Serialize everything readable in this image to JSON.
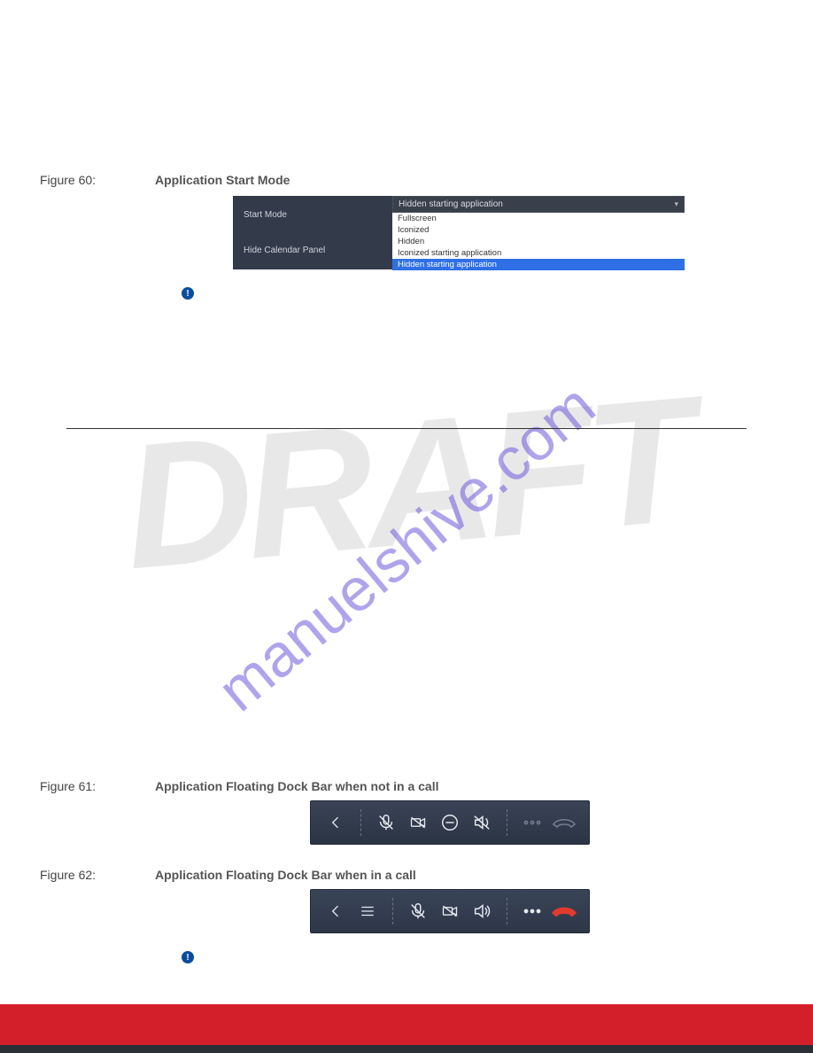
{
  "watermarks": {
    "draft": "DRAFT",
    "url": "manuelshive.com"
  },
  "figures": {
    "f60": {
      "label": "Figure 60:",
      "caption": "Application Start Mode"
    },
    "f61": {
      "label": "Figure 61:",
      "caption": "Application Floating Dock Bar when not in a call"
    },
    "f62": {
      "label": "Figure 62:",
      "caption": "Application Floating Dock Bar when in a call"
    }
  },
  "start_mode": {
    "label_start_mode": "Start Mode",
    "label_hide_calendar": "Hide Calendar Panel",
    "selected": "Hidden starting application",
    "options": [
      "Fullscreen",
      "Iconized",
      "Hidden",
      "Iconized starting application",
      "Hidden starting application"
    ]
  },
  "notice_glyph": "!"
}
